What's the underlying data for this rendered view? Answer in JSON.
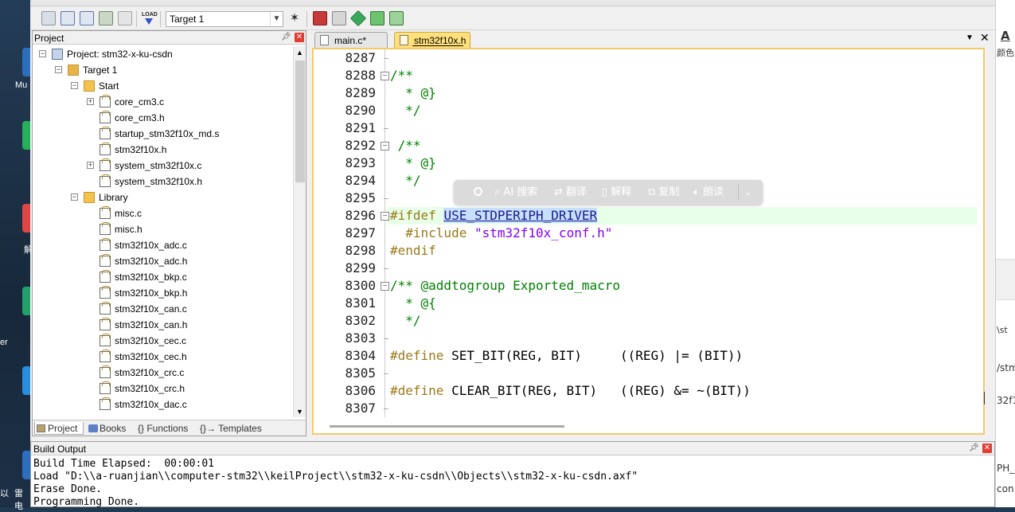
{
  "desktop": {
    "labels": [
      "Mu",
      "解",
      "er",
      "以",
      "雷电"
    ]
  },
  "right_window": {
    "texts": [
      "A",
      "颜色",
      "\\st",
      "/stm",
      "32f1",
      "PH_",
      "con"
    ]
  },
  "toolbar": {
    "target": "Target 1",
    "load_label": "LOAD"
  },
  "project_panel": {
    "title": "Project",
    "tree": [
      {
        "label": "Project: stm32-x-ku-csdn",
        "level": 0,
        "kind": "project",
        "expander": "−"
      },
      {
        "label": "Target 1",
        "level": 1,
        "kind": "target",
        "expander": "−"
      },
      {
        "label": "Start",
        "level": 2,
        "kind": "folder",
        "expander": "−"
      },
      {
        "label": "core_cm3.c",
        "level": 3,
        "kind": "file",
        "expander": "+"
      },
      {
        "label": "core_cm3.h",
        "level": 3,
        "kind": "file",
        "expander": ""
      },
      {
        "label": "startup_stm32f10x_md.s",
        "level": 3,
        "kind": "file",
        "expander": ""
      },
      {
        "label": "stm32f10x.h",
        "level": 3,
        "kind": "file",
        "expander": ""
      },
      {
        "label": "system_stm32f10x.c",
        "level": 3,
        "kind": "file",
        "expander": "+"
      },
      {
        "label": "system_stm32f10x.h",
        "level": 3,
        "kind": "file",
        "expander": ""
      },
      {
        "label": "Library",
        "level": 2,
        "kind": "folder",
        "expander": "−"
      },
      {
        "label": "misc.c",
        "level": 3,
        "kind": "file",
        "expander": ""
      },
      {
        "label": "misc.h",
        "level": 3,
        "kind": "file",
        "expander": ""
      },
      {
        "label": "stm32f10x_adc.c",
        "level": 3,
        "kind": "file",
        "expander": ""
      },
      {
        "label": "stm32f10x_adc.h",
        "level": 3,
        "kind": "file",
        "expander": ""
      },
      {
        "label": "stm32f10x_bkp.c",
        "level": 3,
        "kind": "file",
        "expander": ""
      },
      {
        "label": "stm32f10x_bkp.h",
        "level": 3,
        "kind": "file",
        "expander": ""
      },
      {
        "label": "stm32f10x_can.c",
        "level": 3,
        "kind": "file",
        "expander": ""
      },
      {
        "label": "stm32f10x_can.h",
        "level": 3,
        "kind": "file",
        "expander": ""
      },
      {
        "label": "stm32f10x_cec.c",
        "level": 3,
        "kind": "file",
        "expander": ""
      },
      {
        "label": "stm32f10x_cec.h",
        "level": 3,
        "kind": "file",
        "expander": ""
      },
      {
        "label": "stm32f10x_crc.c",
        "level": 3,
        "kind": "file",
        "expander": ""
      },
      {
        "label": "stm32f10x_crc.h",
        "level": 3,
        "kind": "file",
        "expander": ""
      },
      {
        "label": "stm32f10x_dac.c",
        "level": 3,
        "kind": "file",
        "expander": ""
      }
    ],
    "tabs": [
      "Project",
      "Books",
      "{} Functions",
      "{}→ Templates"
    ]
  },
  "editor": {
    "tabs": [
      {
        "label": "main.c*",
        "active": false
      },
      {
        "label": "stm32f10x.h",
        "active": true
      }
    ],
    "lines": [
      {
        "n": "8287",
        "fold": "",
        "dash": true,
        "segs": []
      },
      {
        "n": "8288",
        "fold": "−",
        "dash": false,
        "segs": [
          {
            "t": "/**",
            "c": "cm"
          }
        ]
      },
      {
        "n": "8289",
        "fold": "",
        "dash": false,
        "segs": [
          {
            "t": "  * @}",
            "c": "cm"
          }
        ]
      },
      {
        "n": "8290",
        "fold": "",
        "dash": false,
        "segs": [
          {
            "t": "  */",
            "c": "cm"
          }
        ]
      },
      {
        "n": "8291",
        "fold": "",
        "dash": true,
        "segs": []
      },
      {
        "n": "8292",
        "fold": "−",
        "dash": false,
        "segs": [
          {
            "t": " /**",
            "c": "cm"
          }
        ]
      },
      {
        "n": "8293",
        "fold": "",
        "dash": false,
        "segs": [
          {
            "t": "  * @}",
            "c": "cm"
          }
        ]
      },
      {
        "n": "8294",
        "fold": "",
        "dash": false,
        "segs": [
          {
            "t": "  */",
            "c": "cm"
          }
        ]
      },
      {
        "n": "8295",
        "fold": "",
        "dash": true,
        "segs": []
      },
      {
        "n": "8296",
        "fold": "−",
        "dash": false,
        "hl": true,
        "segs": [
          {
            "t": "#ifdef ",
            "c": "pp"
          },
          {
            "t": "USE_STDPERIPH_DRIVER",
            "c": "sel"
          }
        ]
      },
      {
        "n": "8297",
        "fold": "",
        "dash": false,
        "segs": [
          {
            "t": "  #include ",
            "c": "pp"
          },
          {
            "t": "\"stm32f10x_conf.h\"",
            "c": "str"
          }
        ]
      },
      {
        "n": "8298",
        "fold": "",
        "dash": false,
        "segs": [
          {
            "t": "#endif",
            "c": "pp"
          }
        ]
      },
      {
        "n": "8299",
        "fold": "",
        "dash": true,
        "segs": []
      },
      {
        "n": "8300",
        "fold": "−",
        "dash": false,
        "segs": [
          {
            "t": "/** @addtogroup Exported_macro",
            "c": "cm"
          }
        ]
      },
      {
        "n": "8301",
        "fold": "",
        "dash": false,
        "segs": [
          {
            "t": "  * @{",
            "c": "cm"
          }
        ]
      },
      {
        "n": "8302",
        "fold": "",
        "dash": false,
        "segs": [
          {
            "t": "  */",
            "c": "cm"
          }
        ]
      },
      {
        "n": "8303",
        "fold": "",
        "dash": true,
        "segs": []
      },
      {
        "n": "8304",
        "fold": "",
        "dash": false,
        "segs": [
          {
            "t": "#define ",
            "c": "pp"
          },
          {
            "t": "SET_BIT(REG, BIT)     ((REG) |= (BIT))",
            "c": ""
          }
        ]
      },
      {
        "n": "8305",
        "fold": "",
        "dash": true,
        "segs": []
      },
      {
        "n": "8306",
        "fold": "",
        "dash": false,
        "segs": [
          {
            "t": "#define ",
            "c": "pp"
          },
          {
            "t": "CLEAR_BIT(REG, BIT)   ((REG) &= ~(BIT))",
            "c": ""
          }
        ]
      },
      {
        "n": "8307",
        "fold": "",
        "dash": true,
        "segs": []
      }
    ]
  },
  "popup": {
    "items": [
      "AI 搜索",
      "翻译",
      "解释",
      "复制",
      "朗读"
    ]
  },
  "build_output": {
    "title": "Build Output",
    "lines": [
      "Build Time Elapsed:  00:00:01",
      "Load \"D:\\\\a-ruanjian\\\\computer-stm32\\\\keilProject\\\\stm32-x-ku-csdn\\\\Objects\\\\stm32-x-ku-csdn.axf\"",
      "Erase Done.",
      "Programming Done."
    ]
  },
  "colors": {
    "comment": "#008000",
    "preprocessor": "#9a7a1a",
    "string": "#8000ff",
    "selection": "#c8e0ff",
    "active_tab": "#ffe07a",
    "close": "#e03c31"
  }
}
